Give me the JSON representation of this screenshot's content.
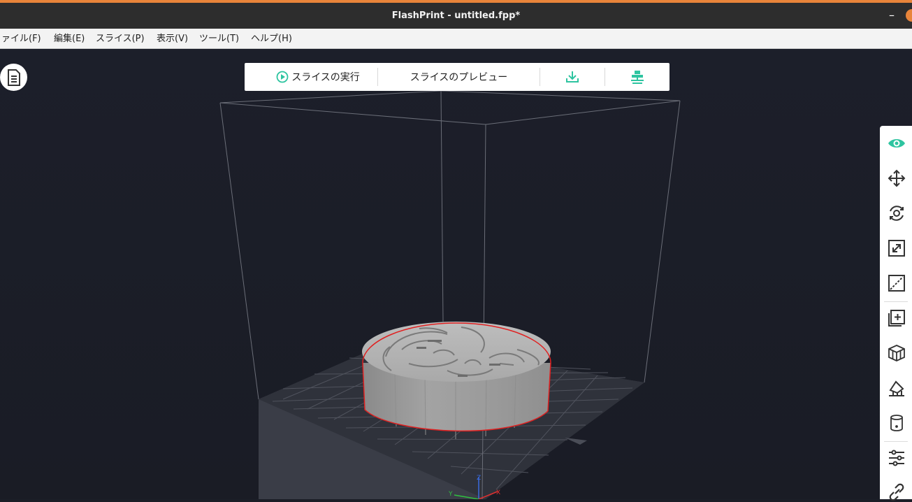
{
  "app": {
    "title": "FlashPrint - untitled.fpp*",
    "minimize_glyph": "–"
  },
  "menu": {
    "file": "ァイル(F)",
    "edit": "編集(E)",
    "slice": "スライス(P)",
    "view": "表示(V)",
    "tools": "ツール(T)",
    "help": "ヘルプ(H)"
  },
  "toolbar": {
    "run_slice": "スライスの実行",
    "preview_slice": "スライスのプレビュー",
    "download_icon": "download-icon",
    "print_icon": "print-send-icon"
  },
  "side_tools": [
    {
      "name": "view",
      "icon": "eye-icon",
      "active": true
    },
    {
      "name": "move",
      "icon": "move-arrows-icon"
    },
    {
      "name": "rotate",
      "icon": "rotate-icon"
    },
    {
      "name": "scale",
      "icon": "scale-icon"
    },
    {
      "name": "cut",
      "icon": "cut-icon"
    },
    {
      "name": "add-object",
      "icon": "add-box-icon"
    },
    {
      "name": "split",
      "icon": "cubes-icon"
    },
    {
      "name": "support",
      "icon": "support-icon"
    },
    {
      "name": "cylinder",
      "icon": "cylinder-icon"
    },
    {
      "name": "settings",
      "icon": "sliders-icon"
    },
    {
      "name": "link",
      "icon": "link-icon"
    }
  ],
  "axes": {
    "x": "X",
    "y": "Y",
    "z": "Z"
  },
  "colors": {
    "accent": "#2ec4a0",
    "window_accent": "#e8843a",
    "selection_outline": "#e02020",
    "background": "#1b1e27"
  }
}
